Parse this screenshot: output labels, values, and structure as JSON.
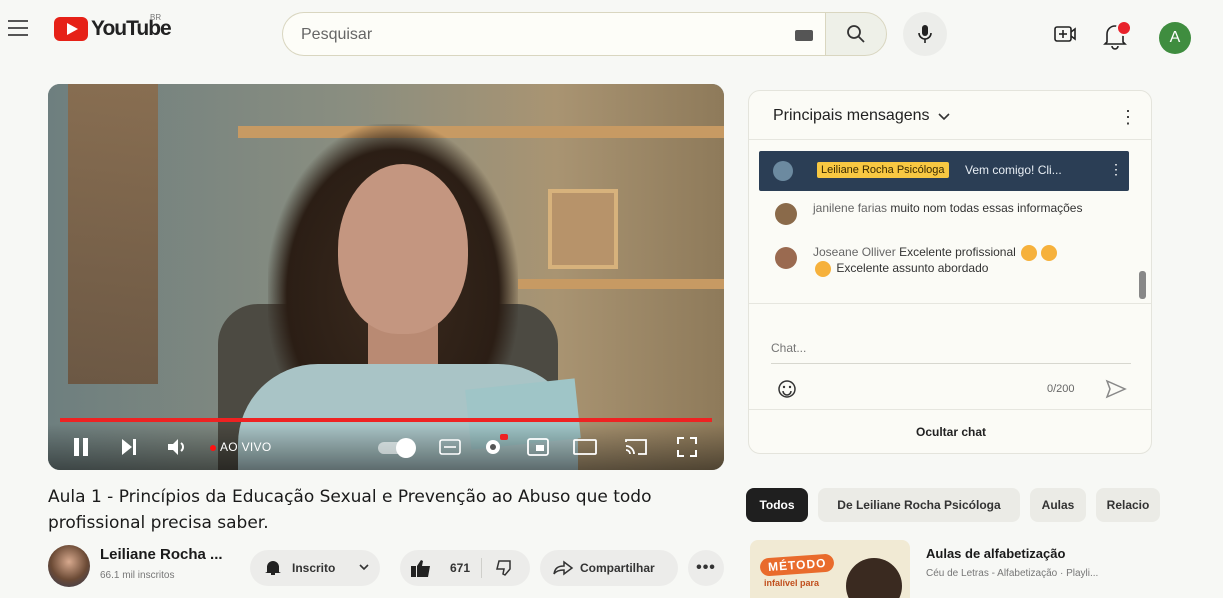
{
  "header": {
    "logo_text": "YouTube",
    "region": "BR",
    "search_placeholder": "Pesquisar",
    "avatar_letter": "A"
  },
  "player": {
    "live_label": "AO VIVO",
    "progress": 1.0
  },
  "video": {
    "title": "Aula 1 - Princípios da Educação Sexual e Prevenção ao Abuso que todo profissional precisa saber.",
    "channel_name": "Leiliane Rocha ...",
    "subscribers": "66.1 mil inscritos",
    "subscribe_label": "Inscrito",
    "likes": "671",
    "share_label": "Compartilhar",
    "more_label": "•••"
  },
  "chat": {
    "header": "Principais mensagens",
    "pinned": {
      "author": "Leiliane Rocha Psicóloga",
      "text": "Vem comigo! Cli..."
    },
    "messages": [
      {
        "author": "janilene farias",
        "text": "muito nom todas essas informações",
        "avatar_color": "#8a6a4a"
      },
      {
        "author": "Joseane Olliver",
        "text": "Excelente profissional",
        "text2": "Excelente assunto abordado",
        "avatar_color": "#9a6a50"
      }
    ],
    "input_placeholder": "Chat...",
    "counter": "0/200",
    "hide_label": "Ocultar chat"
  },
  "chips": [
    "Todos",
    "De Leiliane Rocha Psicóloga",
    "Aulas",
    "Relacio"
  ],
  "recommended": {
    "thumb_badge": "MÉTODO",
    "thumb_sub": "infalível para",
    "title": "Aulas de alfabetização",
    "meta": "Céu de Letras - Alfabetização · Playli..."
  },
  "colors": {
    "brand_red": "#e62117",
    "live_red": "#ff1111",
    "pinned_bg": "#2b3e55",
    "pinned_name_bg": "#f8c842"
  }
}
